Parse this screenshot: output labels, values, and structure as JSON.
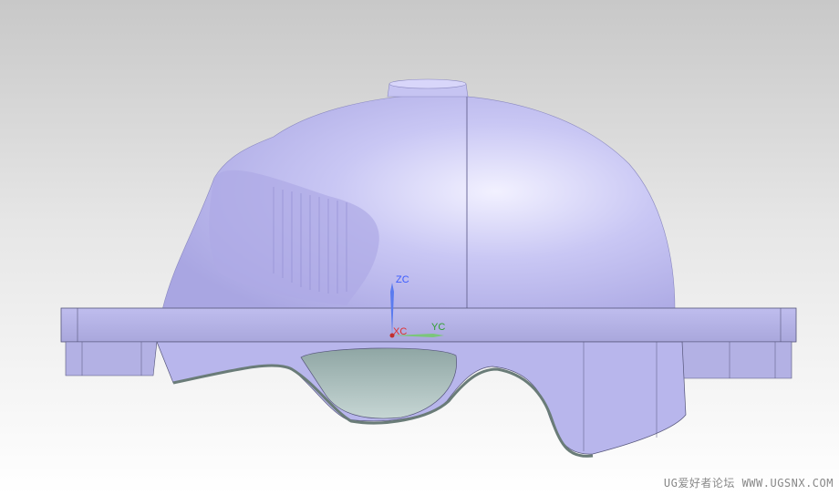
{
  "viewport": {
    "background_top": "#c8c8c8",
    "background_bottom": "#ffffff",
    "model_color": "#b8b6ee",
    "inner_surface_color": "#a9bdbb"
  },
  "triad": {
    "z_label": "ZC",
    "x_label": "XC",
    "y_label": "YC",
    "z_color": "#3a5bff",
    "x_color": "#e03030",
    "y_color": "#30a030"
  },
  "watermark": "UG爱好者论坛 WWW.UGSNX.COM"
}
